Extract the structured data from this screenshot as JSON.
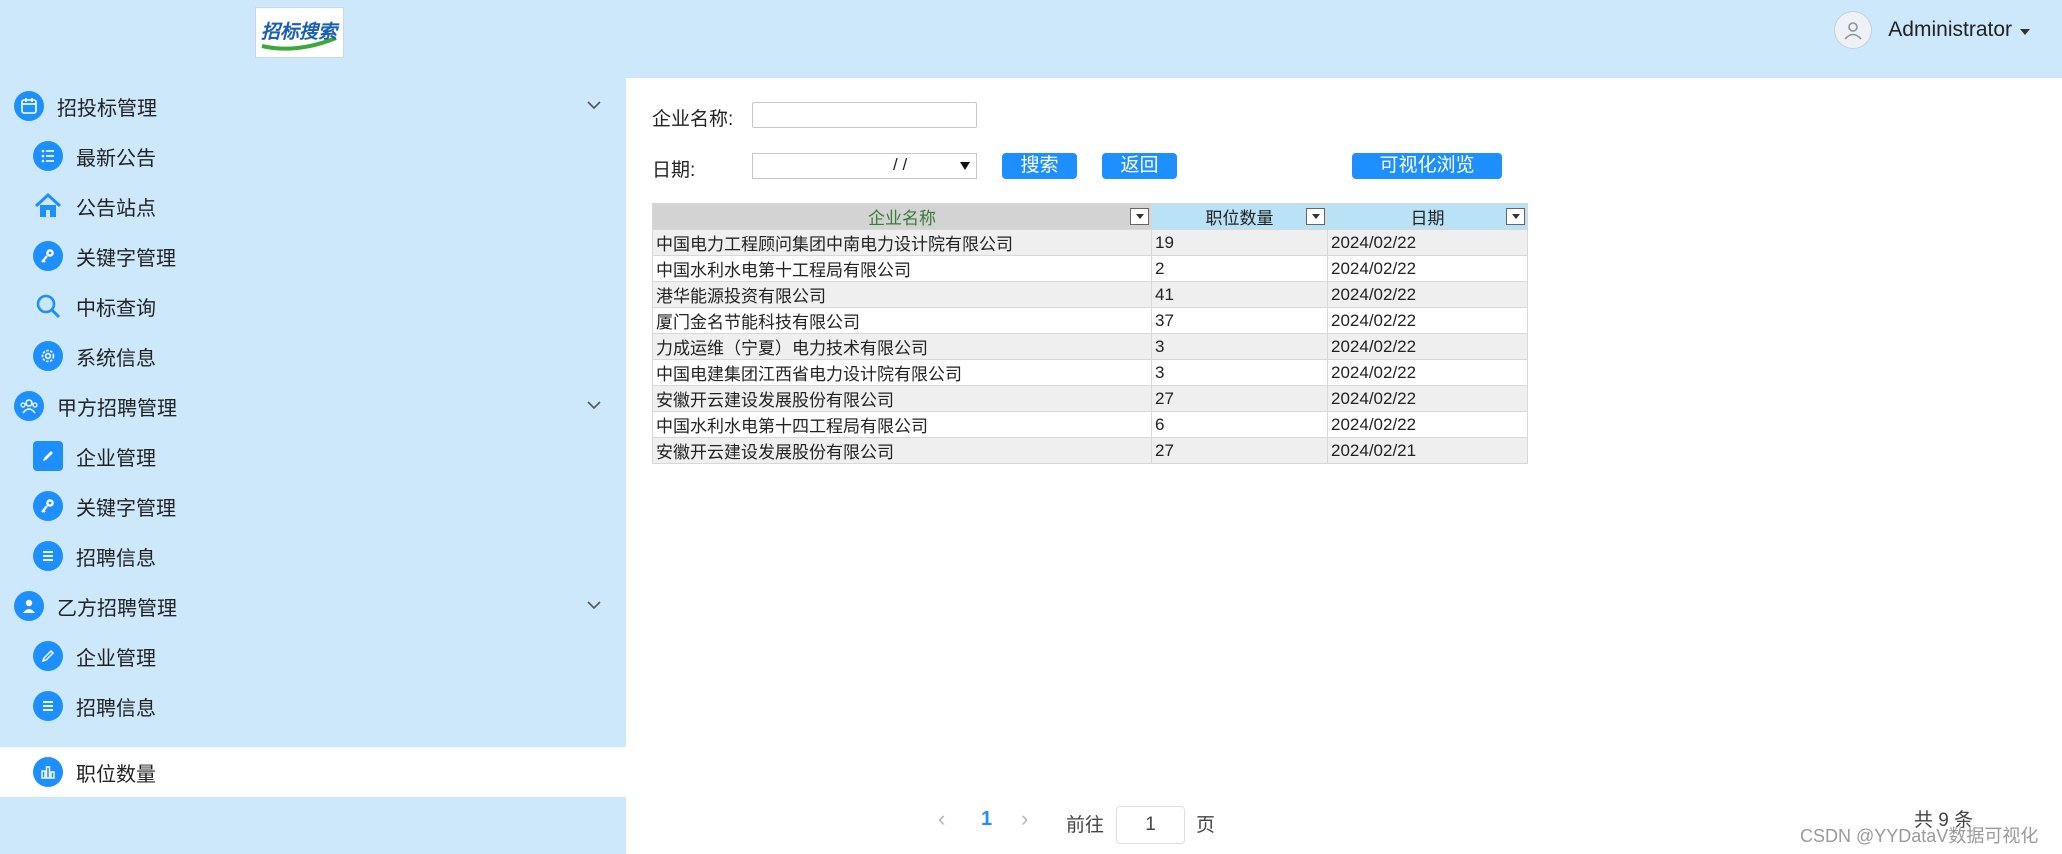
{
  "header": {
    "logo_text": "招标搜索",
    "user_name": "Administrator"
  },
  "sidebar": {
    "groups": [
      {
        "label": "招投标管理",
        "icon": "calendar-icon",
        "items": [
          {
            "label": "最新公告",
            "icon": "list-icon"
          },
          {
            "label": "公告站点",
            "icon": "home-icon"
          },
          {
            "label": "关键字管理",
            "icon": "key-icon"
          },
          {
            "label": "中标查询",
            "icon": "search-icon"
          },
          {
            "label": "系统信息",
            "icon": "gear-icon"
          }
        ]
      },
      {
        "label": "甲方招聘管理",
        "icon": "people-icon",
        "items": [
          {
            "label": "企业管理",
            "icon": "edit-icon"
          },
          {
            "label": "关键字管理",
            "icon": "key-icon"
          },
          {
            "label": "招聘信息",
            "icon": "menu-icon"
          }
        ]
      },
      {
        "label": "乙方招聘管理",
        "icon": "person-icon",
        "items": [
          {
            "label": "企业管理",
            "icon": "pencil-icon"
          },
          {
            "label": "招聘信息",
            "icon": "menu-icon"
          },
          {
            "label": "职位数量",
            "icon": "bar-chart-icon"
          }
        ]
      }
    ]
  },
  "filters": {
    "company_label": "企业名称:",
    "company_value": "",
    "date_label": "日期:",
    "date_value": "/   /",
    "search_button": "搜索",
    "back_button": "返回",
    "visualize_button": "可视化浏览"
  },
  "table": {
    "headers": [
      "企业名称",
      "职位数量",
      "日期"
    ],
    "rows": [
      [
        "中国电力工程顾问集团中南电力设计院有限公司",
        "19",
        "2024/02/22"
      ],
      [
        "中国水利水电第十工程局有限公司",
        "2",
        "2024/02/22"
      ],
      [
        "港华能源投资有限公司",
        "41",
        "2024/02/22"
      ],
      [
        "厦门金名节能科技有限公司",
        "37",
        "2024/02/22"
      ],
      [
        "力成运维（宁夏）电力技术有限公司",
        "3",
        "2024/02/22"
      ],
      [
        "中国电建集团江西省电力设计院有限公司",
        "3",
        "2024/02/22"
      ],
      [
        "安徽开云建设发展股份有限公司",
        "27",
        "2024/02/22"
      ],
      [
        "中国水利水电第十四工程局有限公司",
        "6",
        "2024/02/22"
      ],
      [
        "安徽开云建设发展股份有限公司",
        "27",
        "2024/02/21"
      ]
    ]
  },
  "pagination": {
    "prev": "‹",
    "current_page": "1",
    "next": "›",
    "goto_label": "前往",
    "goto_value": "1",
    "page_suffix": "页",
    "total": "共 9 条"
  },
  "watermark": "CSDN @YYDataV数据可视化",
  "colors": {
    "accent": "#1e8fff",
    "sidebar_bg": "#cde8fb",
    "active_item_bg": "#ffffff"
  }
}
